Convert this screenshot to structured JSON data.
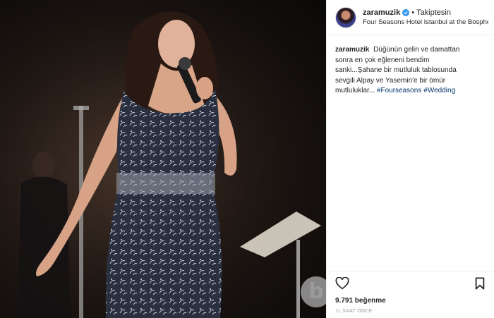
{
  "header": {
    "username": "zaramuzik",
    "separator": "•",
    "follow_status": "Takiptesin",
    "location": "Four Seasons Hotel Istanbul at the Bospho..."
  },
  "caption": {
    "username": "zaramuzik",
    "text": "Düğünün gelin ve damattan sonra en çok eğleneni bendim sanki...Şahane bir mutluluk tablosunda sevgili Alpay ve Yasemin'e bir ömür mutluluklar...",
    "hashtags": [
      "#Fourseasons",
      "#Wedding"
    ]
  },
  "actions": {
    "likes": "9.791 beğenme",
    "timestamp": "11 SAAT ÖNCE"
  },
  "icons": {
    "like": "heart-icon",
    "save": "bookmark-icon",
    "verified": "verified-badge-icon"
  },
  "colors": {
    "verified": "#3897f0",
    "hashtag": "#003569",
    "text": "#262626",
    "muted": "#999999"
  },
  "watermark": "b"
}
